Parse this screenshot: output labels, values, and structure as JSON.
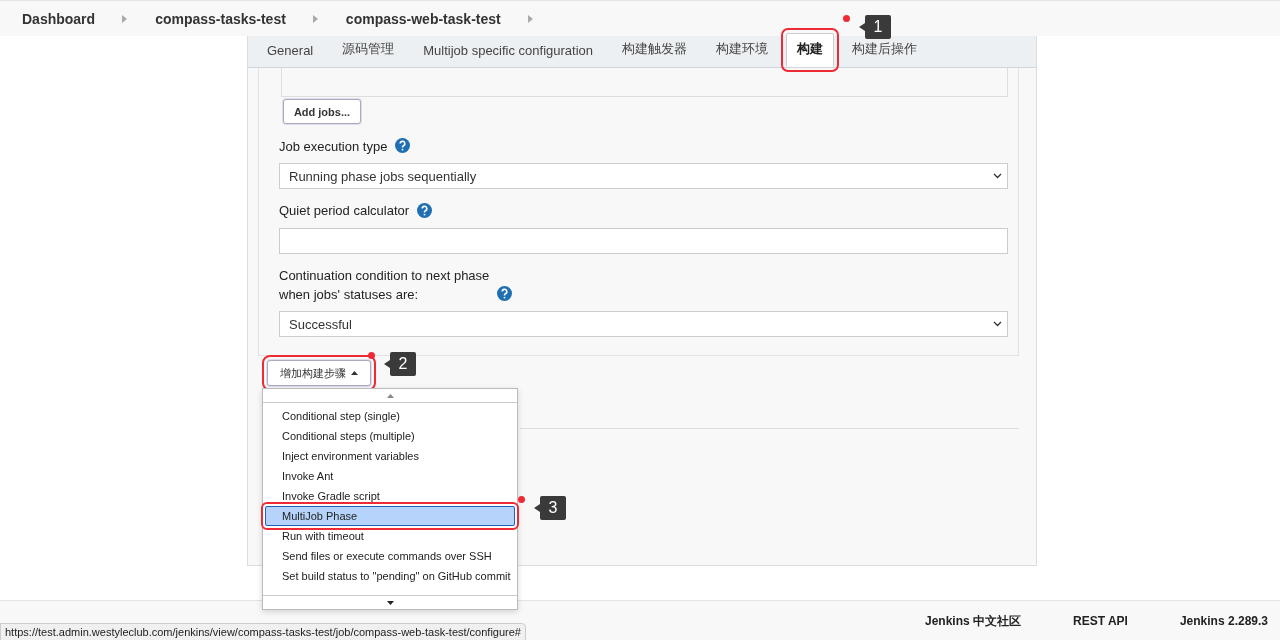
{
  "breadcrumbs": [
    "Dashboard",
    "compass-tasks-test",
    "compass-web-task-test"
  ],
  "tabs": [
    {
      "label": "General",
      "selected": false
    },
    {
      "label": "源码管理",
      "selected": false
    },
    {
      "label": "Multijob specific configuration",
      "selected": false
    },
    {
      "label": "构建触发器",
      "selected": false
    },
    {
      "label": "构建环境",
      "selected": false
    },
    {
      "label": "构建",
      "selected": true,
      "callout": "1"
    },
    {
      "label": "构建后操作",
      "selected": false
    }
  ],
  "add_jobs_button": "Add jobs...",
  "fields": [
    {
      "kind": "select",
      "label": "Job execution type",
      "value": "Running phase jobs sequentially"
    },
    {
      "kind": "input",
      "label": "Quiet period calculator"
    },
    {
      "kind": "select",
      "label": "Continuation condition to next phase",
      "label_line_2": "when jobs' statuses are:",
      "value": "Successful"
    }
  ],
  "add_step_button": {
    "label": "增加构建步骤",
    "expanded": true,
    "callout": "2"
  },
  "step_menu": [
    {
      "label": "Conditional step (single)",
      "selected": false
    },
    {
      "label": "Conditional steps (multiple)",
      "selected": false
    },
    {
      "label": "Inject environment variables",
      "selected": false
    },
    {
      "label": "Invoke Ant",
      "selected": false
    },
    {
      "label": "Invoke Gradle script",
      "selected": false
    },
    {
      "label": "MultiJob Phase",
      "selected": true,
      "callout": "3"
    },
    {
      "label": "Run with timeout",
      "selected": false
    },
    {
      "label": "Send files or execute commands over SSH",
      "selected": false
    },
    {
      "label": "Set build status to \"pending\" on GitHub commit",
      "selected": false
    }
  ],
  "footer": [
    "Jenkins 中文社区",
    "REST API",
    "Jenkins 2.289.3"
  ],
  "status_url": "https://test.admin.westyleclub.com/jenkins/view/compass-tasks-test/job/compass-web-task-test/configure#"
}
